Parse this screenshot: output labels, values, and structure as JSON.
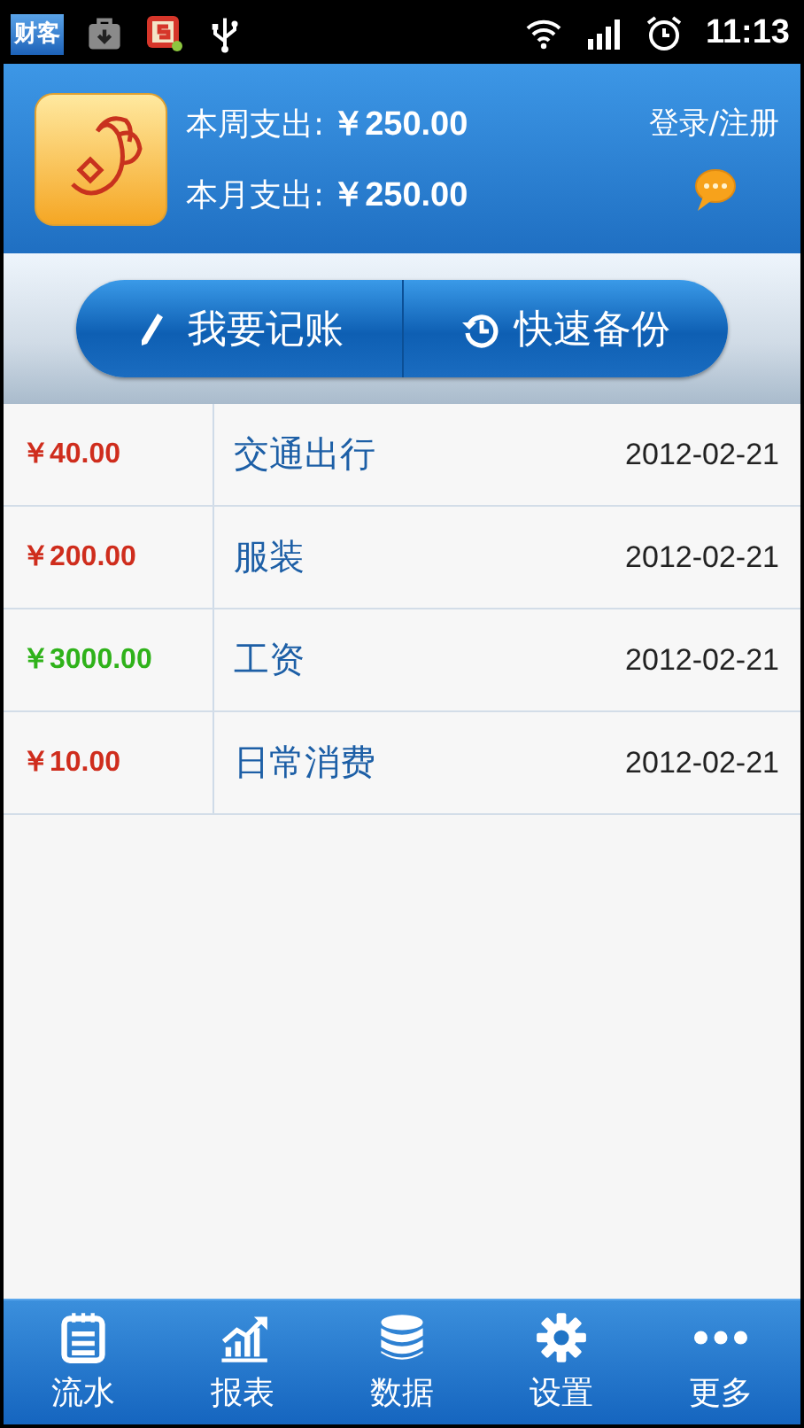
{
  "status_bar": {
    "app_badge": "财客",
    "time": "11:13"
  },
  "header": {
    "week_label": "本周支出:",
    "week_amount": "￥250.00",
    "month_label": "本月支出:",
    "month_amount": "￥250.00",
    "login": "登录/注册"
  },
  "actions": [
    {
      "kind": "record",
      "label": "我要记账"
    },
    {
      "kind": "backup",
      "label": "快速备份"
    }
  ],
  "entries": [
    {
      "kind": "expense",
      "amount": "￥40.00",
      "category": "交通出行",
      "date": "2012-02-21"
    },
    {
      "kind": "expense",
      "amount": "￥200.00",
      "category": "服装",
      "date": "2012-02-21"
    },
    {
      "kind": "income",
      "amount": "￥3000.00",
      "category": "工资",
      "date": "2012-02-21"
    },
    {
      "kind": "expense",
      "amount": "￥10.00",
      "category": "日常消费",
      "date": "2012-02-21"
    }
  ],
  "tab_bar": [
    {
      "kind": "ledger",
      "label": "流水"
    },
    {
      "kind": "report",
      "label": "报表"
    },
    {
      "kind": "data",
      "label": "数据"
    },
    {
      "kind": "settings",
      "label": "设置"
    },
    {
      "kind": "more",
      "label": "更多"
    }
  ]
}
